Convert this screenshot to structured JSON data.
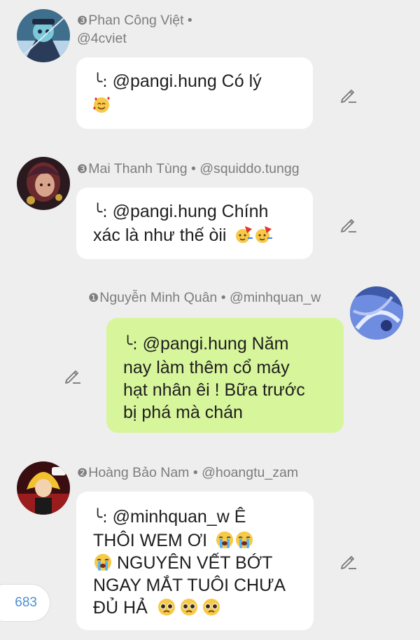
{
  "colors": {
    "background": "#eeeeee",
    "bubble_other": "#ffffff",
    "bubble_mine": "#d7f59b",
    "name_text": "#7d7d7d",
    "counter_text": "#4c8fd0"
  },
  "comments": [
    {
      "rank": "❸",
      "display_name": "Phan Công Việt",
      "separator": "•",
      "handle": "@4cviet",
      "reply_prefix": "╰:",
      "text_lines": [
        "@pangi.hung Có lý"
      ],
      "emojis": [
        "smiling-face-with-hearts-emoji"
      ],
      "edit_icon": "pencil-icon"
    },
    {
      "rank": "❸",
      "display_name": "Mai Thanh Tùng",
      "separator": "•",
      "handle": "@squiddo.tungg",
      "reply_prefix": "╰:",
      "text_lines": [
        "@pangi.hung Chính",
        "xác là như thế òii"
      ],
      "emojis": [
        "partying-face-emoji",
        "partying-face-emoji"
      ],
      "edit_icon": "pencil-icon"
    },
    {
      "rank": "❶",
      "display_name": "Nguyễn Minh Quân",
      "separator": "•",
      "handle": "@minhquan_w",
      "reply_prefix": "╰:",
      "text_lines": [
        "@pangi.hung Năm",
        "nay làm thêm cổ máy",
        "hạt nhân êi ! Bữa trước",
        "bị phá mà chán"
      ],
      "edit_icon": "pencil-icon"
    },
    {
      "rank": "❷",
      "display_name": "Hoàng Bảo Nam",
      "separator": "•",
      "handle": "@hoangtu_zam",
      "reply_prefix": "╰:",
      "text_lines": [
        "@minhquan_w Ê",
        "THÔI WEM ƠI",
        "NGUYÊN VẾT BỚT",
        "NGAY MẮT TUÔI CHƯA",
        "ĐỦ HẢ"
      ],
      "emojis": [
        "loudly-crying-face-emoji",
        "pleading-face-emoji"
      ],
      "edit_icon": "pencil-icon"
    }
  ],
  "counter": {
    "value": "683"
  }
}
